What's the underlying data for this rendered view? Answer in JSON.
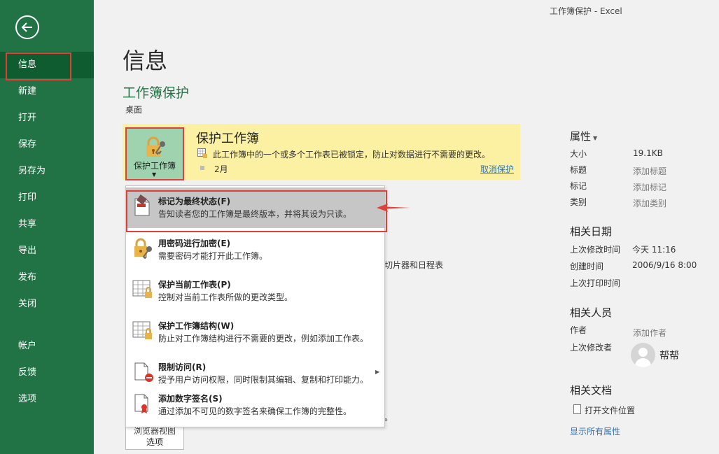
{
  "window": {
    "title": "工作簿保护  -  Excel"
  },
  "colors": {
    "brand": "#217346",
    "active": "#0e5c2f",
    "highlight_border": "#e0403a",
    "band": "#fcf1a3",
    "link": "#2e74b5"
  },
  "sidebar": {
    "back_icon": "back-arrow-icon",
    "items": [
      {
        "label": "信息"
      },
      {
        "label": "新建"
      },
      {
        "label": "打开"
      },
      {
        "label": "保存"
      },
      {
        "label": "另存为"
      },
      {
        "label": "打印"
      },
      {
        "label": "共享"
      },
      {
        "label": "导出"
      },
      {
        "label": "发布"
      },
      {
        "label": "关闭"
      },
      {
        "label": "帐户"
      },
      {
        "label": "反馈"
      },
      {
        "label": "选项"
      }
    ]
  },
  "main": {
    "title": "信息",
    "workbook_name": "工作簿保护",
    "location": "桌面",
    "protect": {
      "button_label": "保护工作簿",
      "heading": "保护工作簿",
      "description": "此工作簿中的一个或多个工作表已被锁定，防止对数据进行不需要的更改。",
      "date": "2月",
      "unprotect_link": "取消保护"
    },
    "background_fragments": {
      "frag1": "切片器和日程表",
      "frag2": "。",
      "browser_button_line1": "浏览器视图",
      "browser_button_line2": "选项"
    },
    "dropdown": [
      {
        "title": "标记为最终状态(F)",
        "desc": "告知读者您的工作簿是最终版本，并将其设为只读。",
        "icon": "mark-final-icon"
      },
      {
        "title": "用密码进行加密(E)",
        "desc": "需要密码才能打开此工作簿。",
        "icon": "encrypt-lock-icon"
      },
      {
        "title": "保护当前工作表(P)",
        "desc": "控制对当前工作表所做的更改类型。",
        "icon": "protect-sheet-icon"
      },
      {
        "title": "保护工作簿结构(W)",
        "desc": "防止对工作簿结构进行不需要的更改，例如添加工作表。",
        "icon": "protect-structure-icon"
      },
      {
        "title": "限制访问(R)",
        "desc": "授予用户访问权限，同时限制其编辑、复制和打印能力。",
        "icon": "restrict-access-icon"
      },
      {
        "title": "添加数字签名(S)",
        "desc": "通过添加不可见的数字签名来确保工作簿的完整性。",
        "icon": "digital-signature-icon"
      }
    ]
  },
  "properties": {
    "heading": "属性",
    "size_label": "大小",
    "size_value": "19.1KB",
    "title_label": "标题",
    "title_value": "添加标题",
    "tags_label": "标记",
    "tags_value": "添加标记",
    "category_label": "类别",
    "category_value": "添加类别",
    "dates_heading": "相关日期",
    "modified_label": "上次修改时间",
    "modified_value": "今天 11:16",
    "created_label": "创建时间",
    "created_value": "2006/9/16 8:00",
    "printed_label": "上次打印时间",
    "people_heading": "相关人员",
    "author_label": "作者",
    "author_value": "添加作者",
    "last_modified_by_label": "上次修改者",
    "last_modified_by_value": "帮帮",
    "docs_heading": "相关文档",
    "open_location": "打开文件位置",
    "show_all": "显示所有属性"
  }
}
